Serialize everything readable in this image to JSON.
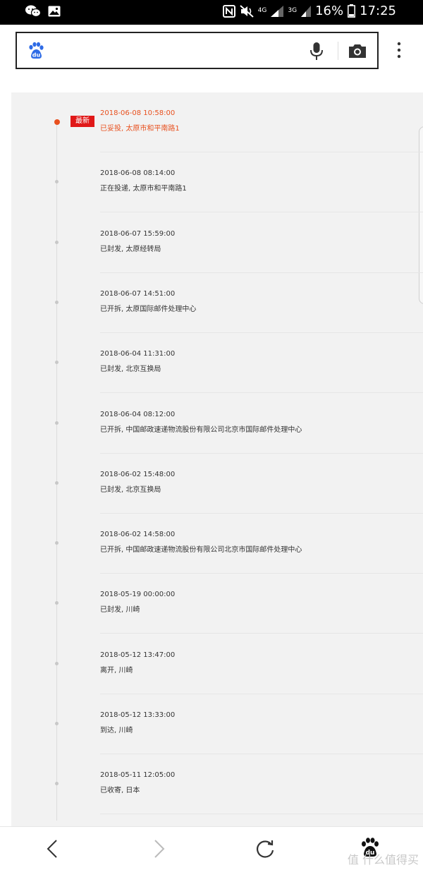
{
  "status_bar": {
    "network_4g": "4G",
    "network_3g": "3G",
    "battery": "16%",
    "time": "17:25"
  },
  "search": {
    "placeholder": ""
  },
  "tracking": {
    "latest_badge": "最新",
    "events": [
      {
        "time": "2018-06-08 10:58:00",
        "desc": "已妥投, 太原市和平南路1",
        "latest": true
      },
      {
        "time": "2018-06-08 08:14:00",
        "desc": "正在投递, 太原市和平南路1"
      },
      {
        "time": "2018-06-07 15:59:00",
        "desc": "已封发, 太原经转局"
      },
      {
        "time": "2018-06-07 14:51:00",
        "desc": "已开拆, 太原国际邮件处理中心"
      },
      {
        "time": "2018-06-04 11:31:00",
        "desc": "已封发, 北京互换局"
      },
      {
        "time": "2018-06-04 08:12:00",
        "desc": "已开拆, 中国邮政速递物流股份有限公司北京市国际邮件处理中心"
      },
      {
        "time": "2018-06-02 15:48:00",
        "desc": "已封发, 北京互换局"
      },
      {
        "time": "2018-06-02 14:58:00",
        "desc": "已开拆, 中国邮政速递物流股份有限公司北京市国际邮件处理中心"
      },
      {
        "time": "2018-05-19 00:00:00",
        "desc": "已封发, 川崎"
      },
      {
        "time": "2018-05-12 13:47:00",
        "desc": "离开, 川崎"
      },
      {
        "time": "2018-05-12 13:33:00",
        "desc": "到达, 川崎"
      },
      {
        "time": "2018-05-11 12:05:00",
        "desc": "已收寄, 日本"
      }
    ]
  },
  "watermark": "值 什么值得买",
  "colors": {
    "accent": "#e8501e",
    "badge": "#e01818",
    "baidu_blue": "#2e6be6"
  },
  "icons": {
    "wechat": "wechat-icon",
    "gallery": "gallery-icon",
    "nfc": "nfc-icon",
    "mute": "mute-icon",
    "signal": "signal-icon",
    "battery": "battery-icon",
    "mic": "mic-icon",
    "camera": "camera-icon",
    "menu": "more-vertical-icon",
    "back": "back-icon",
    "forward": "forward-icon",
    "refresh": "refresh-icon",
    "baidu": "baidu-paw-icon"
  }
}
